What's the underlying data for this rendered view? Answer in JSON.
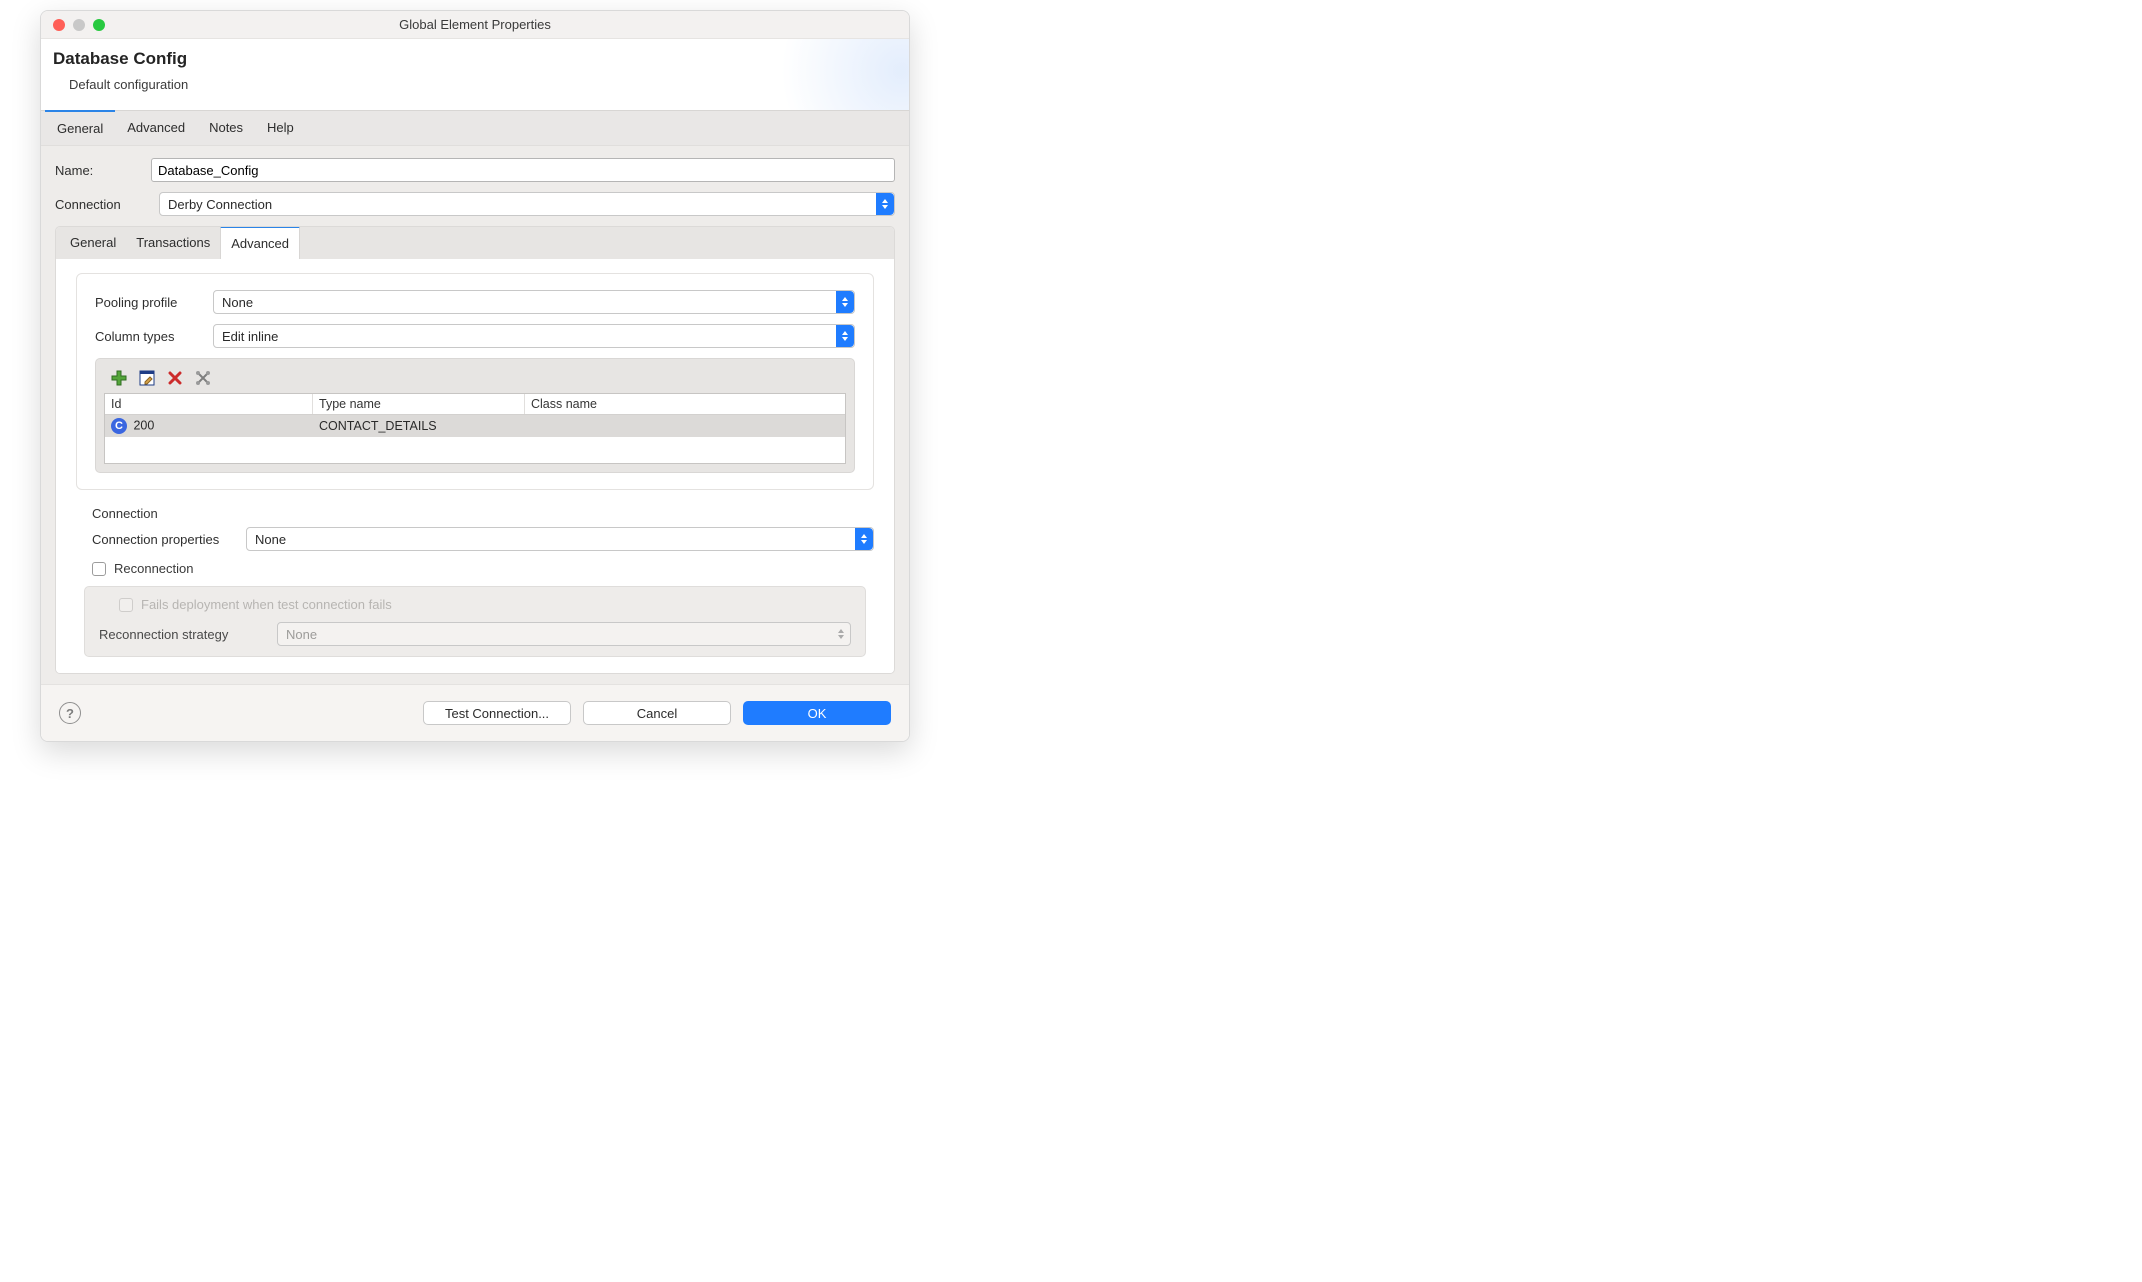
{
  "titlebar": {
    "title": "Global Element Properties"
  },
  "header": {
    "heading": "Database Config",
    "sub": "Default configuration"
  },
  "top_tabs": [
    "General",
    "Advanced",
    "Notes",
    "Help"
  ],
  "top_tab_active": 0,
  "form": {
    "name_label": "Name:",
    "name_value": "Database_Config",
    "connection_label": "Connection",
    "connection_value": "Derby Connection"
  },
  "inner_tabs": [
    "General",
    "Transactions",
    "Advanced"
  ],
  "inner_tab_active": 2,
  "advanced_tab": {
    "pooling_label": "Pooling profile",
    "pooling_value": "None",
    "coltypes_label": "Column types",
    "coltypes_value": "Edit inline",
    "toolbar_icons": [
      "add-icon",
      "edit-icon",
      "delete-icon",
      "tools-icon"
    ],
    "table_headers": [
      "Id",
      "Type name",
      "Class name"
    ],
    "table_rows": [
      {
        "id": "200",
        "type_name": "CONTACT_DETAILS",
        "class_name": ""
      }
    ]
  },
  "connection_section": {
    "title": "Connection",
    "props_label": "Connection properties",
    "props_value": "None",
    "reconnection_label": "Reconnection",
    "fails_label": "Fails deployment when test connection fails",
    "strategy_label": "Reconnection strategy",
    "strategy_value": "None"
  },
  "footer": {
    "test": "Test Connection...",
    "cancel": "Cancel",
    "ok": "OK"
  }
}
